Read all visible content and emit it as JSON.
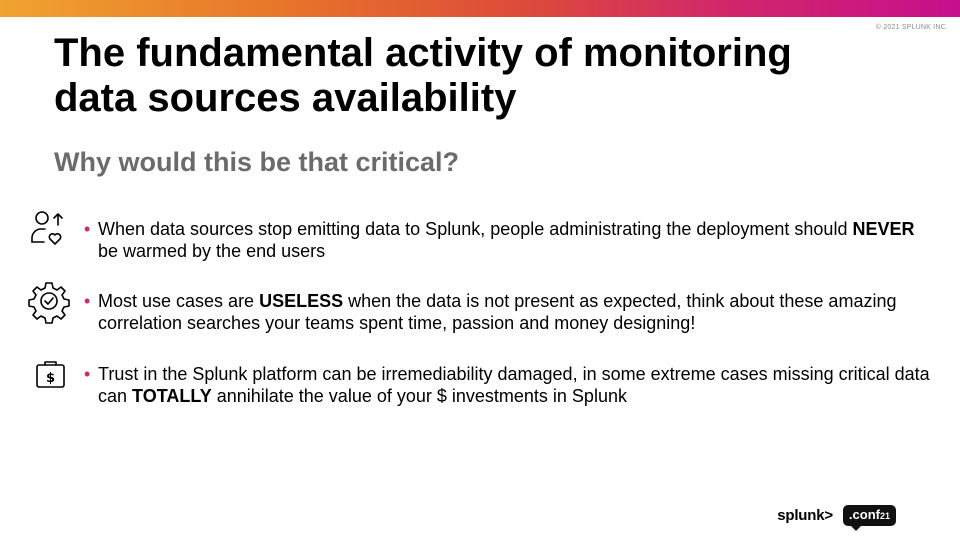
{
  "header": {
    "copyright": "© 2021 SPLUNK INC.",
    "title": "The fundamental activity of monitoring data sources availability",
    "subtitle": "Why would this be that critical?"
  },
  "bullets": [
    {
      "icon": "user-heart-icon",
      "part1": "When data sources stop emitting data to Splunk, people administrating the deployment should ",
      "bold": "NEVER",
      "part2": " be warmed by the end users"
    },
    {
      "icon": "gear-check-icon",
      "part1": "Most use cases are ",
      "bold": "USELESS",
      "part2": " when the data is not present as expected, think about these amazing correlation searches your teams spent time, passion and money designing!"
    },
    {
      "icon": "money-case-icon",
      "part1": "Trust in the Splunk platform can be irremediability damaged, in some extreme cases missing critical data can ",
      "bold": "TOTALLY",
      "part2": " annihilate the value of your $ investments in Splunk"
    }
  ],
  "footer": {
    "brand": "splunk>",
    "conf_label": ".conf",
    "conf_year": "21"
  },
  "colors": {
    "accent_pink": "#d1286a",
    "gradient_start": "#f0a330",
    "gradient_end": "#c70f8c",
    "subtitle_gray": "#6b6b6b"
  }
}
